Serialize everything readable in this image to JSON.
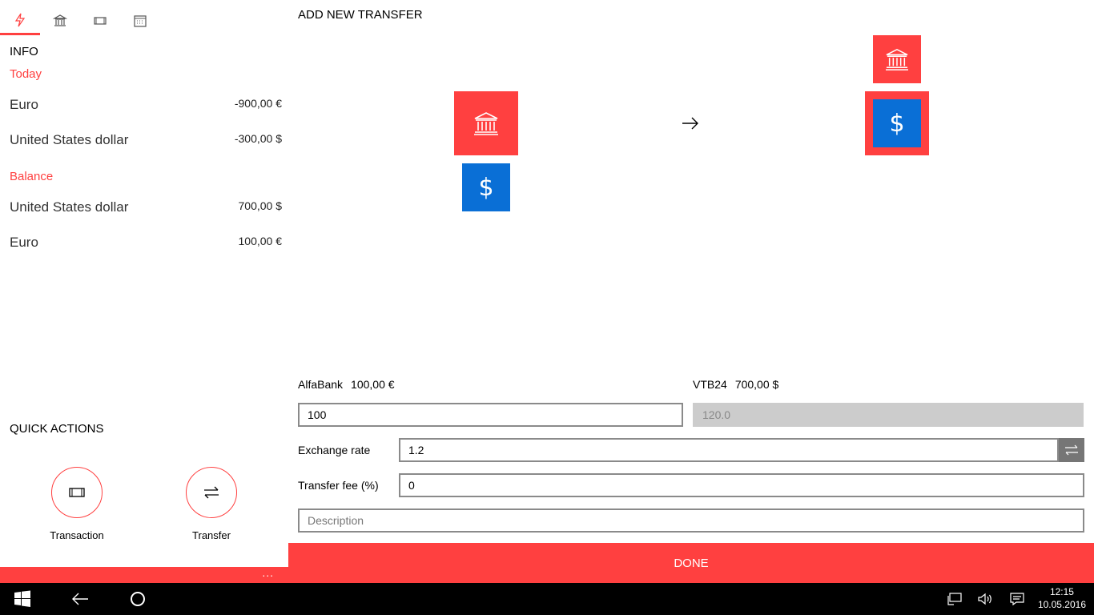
{
  "nav": {
    "tabs": [
      {
        "icon": "lightning-icon",
        "active": true
      },
      {
        "icon": "bank-icon",
        "active": false
      },
      {
        "icon": "transaction-icon",
        "active": false
      },
      {
        "icon": "calendar-icon",
        "active": false
      }
    ]
  },
  "info": {
    "title": "INFO",
    "today_label": "Today",
    "today_rows": [
      {
        "name": "Euro",
        "value": "-900,00 €"
      },
      {
        "name": "United States dollar",
        "value": "-300,00 $"
      }
    ],
    "balance_label": "Balance",
    "balance_rows": [
      {
        "name": "United States dollar",
        "value": "700,00 $"
      },
      {
        "name": "Euro",
        "value": "100,00 €"
      }
    ]
  },
  "quick_actions": {
    "title": "QUICK ACTIONS",
    "transaction_label": "Transaction",
    "transfer_label": "Transfer",
    "more": "..."
  },
  "transfer": {
    "title": "ADD NEW TRANSFER",
    "from_name": "AlfaBank",
    "from_balance": "100,00 €",
    "to_name": "VTB24",
    "to_balance": "700,00 $",
    "amount_value": "100",
    "converted_value": "120.0",
    "exchange_label": "Exchange rate",
    "exchange_value": "1.2",
    "fee_label": "Transfer fee (%)",
    "fee_value": "0",
    "description_placeholder": "Description",
    "done_label": "DONE",
    "dollar_symbol": "$"
  },
  "taskbar": {
    "time": "12:15",
    "date": "10.05.2016"
  },
  "colors": {
    "accent": "#ff4040",
    "blue": "#0a6fd6"
  }
}
